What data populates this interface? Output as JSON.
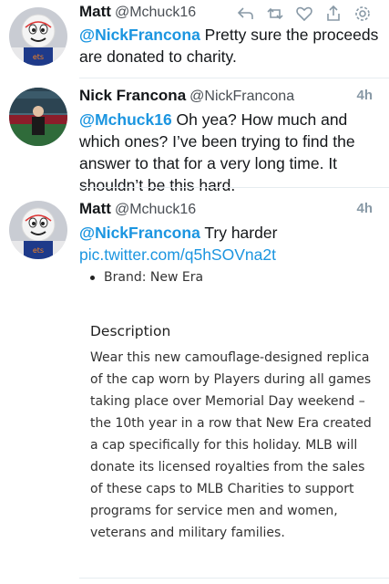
{
  "tweets": [
    {
      "name": "Matt",
      "handle": "@Mchuck16",
      "mention": "@NickFrancona",
      "text": " Pretty sure the proceeds are donated to charity.",
      "actions": [
        "reply-icon",
        "retweet-icon",
        "like-icon",
        "share-icon",
        "settings-icon"
      ]
    },
    {
      "name": "Nick Francona",
      "handle": "@NickFrancona",
      "time": "4h",
      "mention": "@Mchuck16",
      "text": " Oh yea? How much and which ones? I’ve been trying to find the answer to that for a very long time. It shouldn’t be this hard."
    },
    {
      "name": "Matt",
      "handle": "@Mchuck16",
      "time": "4h",
      "mention": "@NickFrancona",
      "text": " Try harder",
      "link": "pic.twitter.com/q5hSOVna2t"
    }
  ],
  "attachment": {
    "brand": "Brand: New Era",
    "description_title": "Description",
    "description": "Wear this new camouflage-designed replica of the cap worn by Players during all games taking place over Memorial Day weekend – the 10th year in a row that New Era created a cap specifically for this holiday. MLB will donate its licensed royalties from the sales of these caps to MLB Charities to support programs for service men and women, veterans and military families."
  }
}
